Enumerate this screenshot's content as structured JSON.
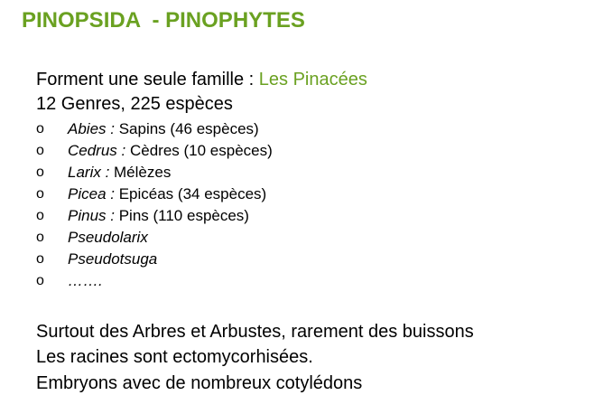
{
  "title": "PINOPSIDA  - PINOPHYTES",
  "intro": {
    "family_prefix": "Forment une seule famille : ",
    "family_name": "Les Pinacées",
    "counts": "12 Genres, 225 espèces"
  },
  "bullet_glyph": "o",
  "genera": [
    {
      "genus": "Abies :",
      "desc": " Sapins (46 espèces)"
    },
    {
      "genus": "Cedrus :",
      "desc": " Cèdres (10 espèces)"
    },
    {
      "genus": "Larix :",
      "desc": " Mélèzes"
    },
    {
      "genus": "Picea :",
      "desc": " Epicéas (34 espèces)"
    },
    {
      "genus": "Pinus :",
      "desc": " Pins (110 espèces)"
    },
    {
      "genus": "Pseudolarix",
      "desc": ""
    },
    {
      "genus": "Pseudotsuga",
      "desc": ""
    },
    {
      "genus": "…….",
      "desc": ""
    }
  ],
  "notes": [
    "Surtout des Arbres et Arbustes, rarement des buissons",
    "Les racines sont ectomycorhisées.",
    "Embryons avec de nombreux cotylédons"
  ],
  "colors": {
    "accent": "#6aa121",
    "text": "#000000"
  }
}
